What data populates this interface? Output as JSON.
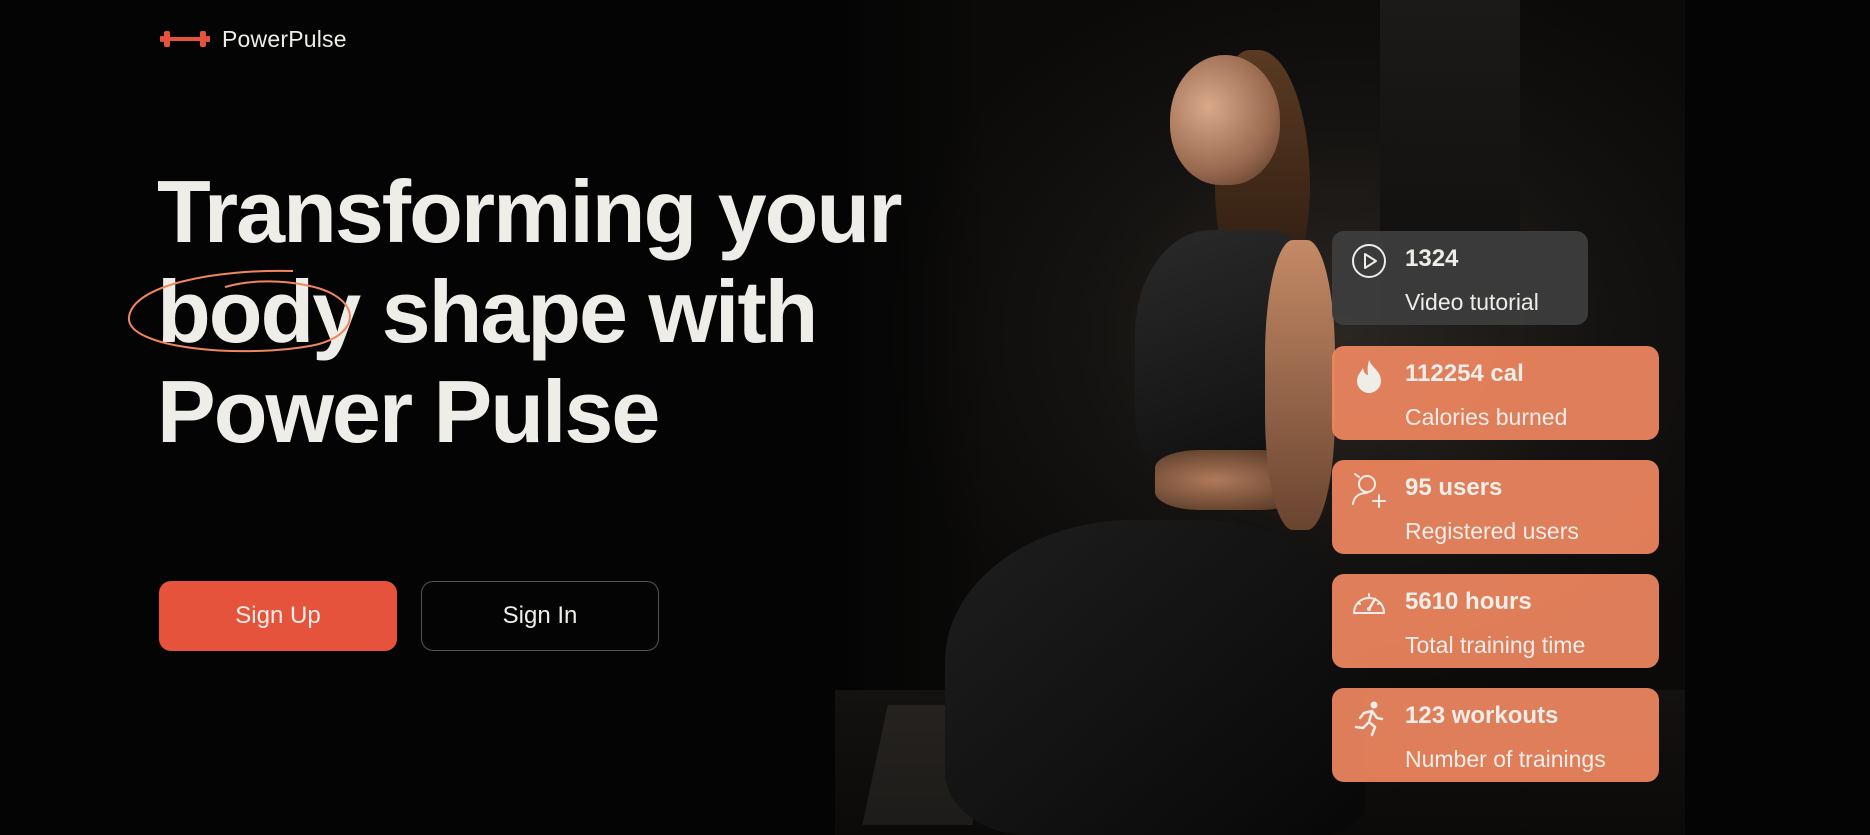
{
  "brand": {
    "name": "PowerPulse",
    "icon": "dumbbell-icon",
    "accent": "#e6533c"
  },
  "headline": {
    "line1": "Transforming your",
    "line2_highlight": "body",
    "line2_rest": "shape with",
    "line3": "Power Pulse"
  },
  "actions": {
    "signup_label": "Sign Up",
    "signin_label": "Sign In"
  },
  "stats": [
    {
      "icon": "play-icon",
      "value": "1324",
      "label": "Video tutorial"
    },
    {
      "icon": "flame-icon",
      "value": "112254 cal",
      "label": "Calories burned"
    },
    {
      "icon": "users-add-icon",
      "value": "95 users",
      "label": "Registered users"
    },
    {
      "icon": "speedometer-icon",
      "value": "5610 hours",
      "label": "Total training time"
    },
    {
      "icon": "running-icon",
      "value": "123 workouts",
      "label": "Number of trainings"
    }
  ],
  "colors": {
    "background": "#040404",
    "card_orange": "#ef8660",
    "card_dark": "#3e3e3e",
    "text": "#efede8"
  }
}
